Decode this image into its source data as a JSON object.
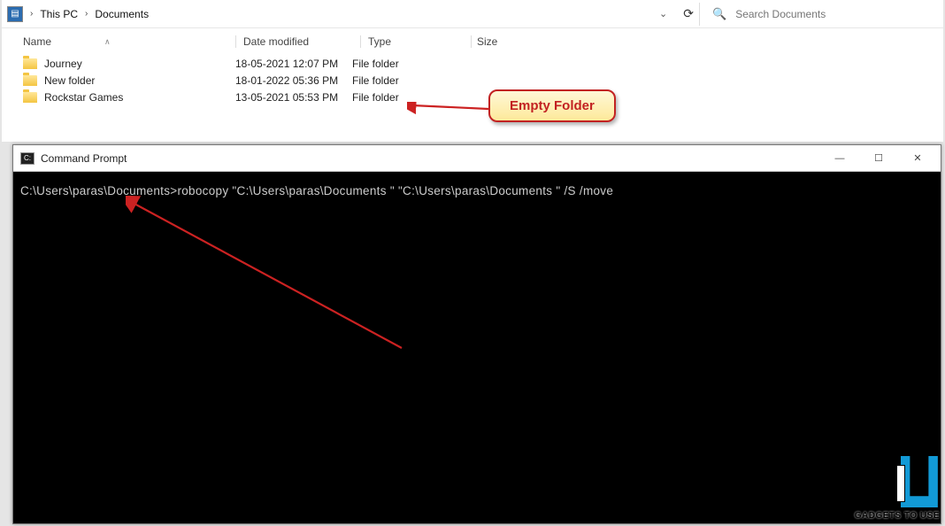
{
  "explorer": {
    "breadcrumb": [
      "This PC",
      "Documents"
    ],
    "search_placeholder": "Search Documents",
    "columns": {
      "name": "Name",
      "date": "Date modified",
      "type": "Type",
      "size": "Size"
    },
    "rows": [
      {
        "name": "Journey",
        "date": "18-05-2021 12:07 PM",
        "type": "File folder",
        "size": ""
      },
      {
        "name": "New folder",
        "date": "18-01-2022 05:36 PM",
        "type": "File folder",
        "size": ""
      },
      {
        "name": "Rockstar Games",
        "date": "13-05-2021 05:53 PM",
        "type": "File folder",
        "size": ""
      }
    ]
  },
  "callout": {
    "label": "Empty Folder"
  },
  "cmd": {
    "title": "Command Prompt",
    "prompt": "C:\\Users\\paras\\Documents>",
    "command": "robocopy \"C:\\Users\\paras\\Documents \" \"C:\\Users\\paras\\Documents \" /S /move"
  },
  "watermark": {
    "text": "GADGETS TO USE"
  },
  "colors": {
    "accent_red": "#c22222",
    "callout_bg": "#fde99a",
    "cmd_bg": "#000000",
    "brand_blue": "#129ad6"
  }
}
